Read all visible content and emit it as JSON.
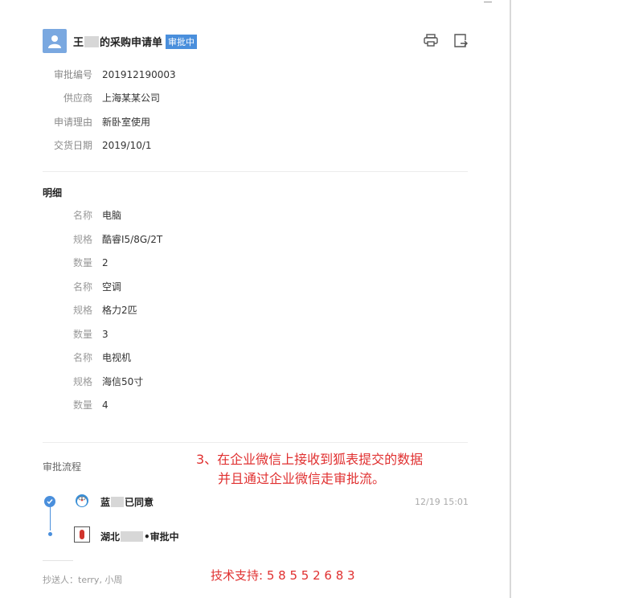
{
  "header": {
    "title_prefix": "王",
    "title_suffix": "的采购申请单",
    "status_badge": "审批中"
  },
  "fields": [
    {
      "label": "审批编号",
      "value": "201912190003"
    },
    {
      "label": "供应商",
      "value": "上海某某公司"
    },
    {
      "label": "申请理由",
      "value": "新卧室使用"
    },
    {
      "label": "交货日期",
      "value": "2019/10/1"
    }
  ],
  "details": {
    "section_title": "明细",
    "rows": [
      {
        "label": "名称",
        "value": "电脑"
      },
      {
        "label": "规格",
        "value": "酷睿I5/8G/2T"
      },
      {
        "label": "数量",
        "value": "2"
      },
      {
        "label": "名称",
        "value": "空调"
      },
      {
        "label": "规格",
        "value": "格力2匹"
      },
      {
        "label": "数量",
        "value": "3"
      },
      {
        "label": "名称",
        "value": "电视机"
      },
      {
        "label": "规格",
        "value": "海信50寸"
      },
      {
        "label": "数量",
        "value": "4"
      }
    ]
  },
  "flow": {
    "section_title": "审批流程",
    "steps": [
      {
        "name_prefix": "蓝",
        "name_suffix": "已同意",
        "time": "12/19 15:01"
      },
      {
        "name_prefix": "湖北",
        "name_suffix": "•审批中",
        "time": ""
      }
    ]
  },
  "cc": "抄送人：terry, 小周",
  "annotation": {
    "line1": "3、在企业微信上接收到狐表提交的数据",
    "line2": "并且通过企业微信走审批流。"
  },
  "support": "技术支持: 5 8 5 5 2 6 8 3",
  "colors": {
    "accent": "#4a8fdc",
    "annotation": "#e03030"
  }
}
